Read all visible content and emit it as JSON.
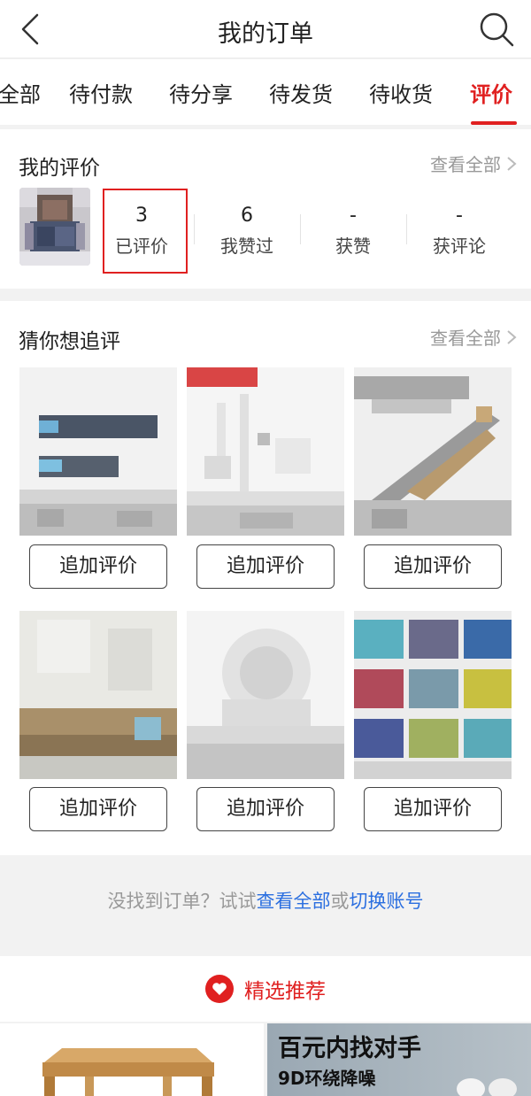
{
  "header": {
    "title": "我的订单",
    "back_icon": "chevron-left-icon",
    "search_icon": "search-icon"
  },
  "tabs": [
    {
      "label": "全部",
      "active": false
    },
    {
      "label": "待付款",
      "active": false
    },
    {
      "label": "待分享",
      "active": false
    },
    {
      "label": "待发货",
      "active": false
    },
    {
      "label": "待收货",
      "active": false
    },
    {
      "label": "评价",
      "active": true
    }
  ],
  "my_reviews": {
    "title": "我的评价",
    "see_all": "查看全部",
    "stats": [
      {
        "num": "3",
        "label": "已评价"
      },
      {
        "num": "6",
        "label": "我赞过"
      },
      {
        "num": "-",
        "label": "获赞"
      },
      {
        "num": "-",
        "label": "获评论"
      }
    ]
  },
  "guess": {
    "title": "猜你想追评",
    "see_all": "查看全部",
    "products": [
      {
        "button": "追加评价"
      },
      {
        "button": "追加评价"
      },
      {
        "button": "追加评价"
      },
      {
        "button": "追加评价"
      },
      {
        "button": "追加评价"
      },
      {
        "button": "追加评价"
      }
    ]
  },
  "footer_note": {
    "prefix": "没找到订单？试试",
    "link1": "查看全部",
    "mid": "或",
    "link2": "切换账号"
  },
  "recommend": {
    "label": "精选推荐",
    "icon": "heart-badge-icon"
  },
  "ad": {
    "title": "百元内找对手",
    "subtitle": "9D环绕降噪"
  },
  "colors": {
    "accent": "#e02020",
    "link": "#2b6fe0"
  }
}
